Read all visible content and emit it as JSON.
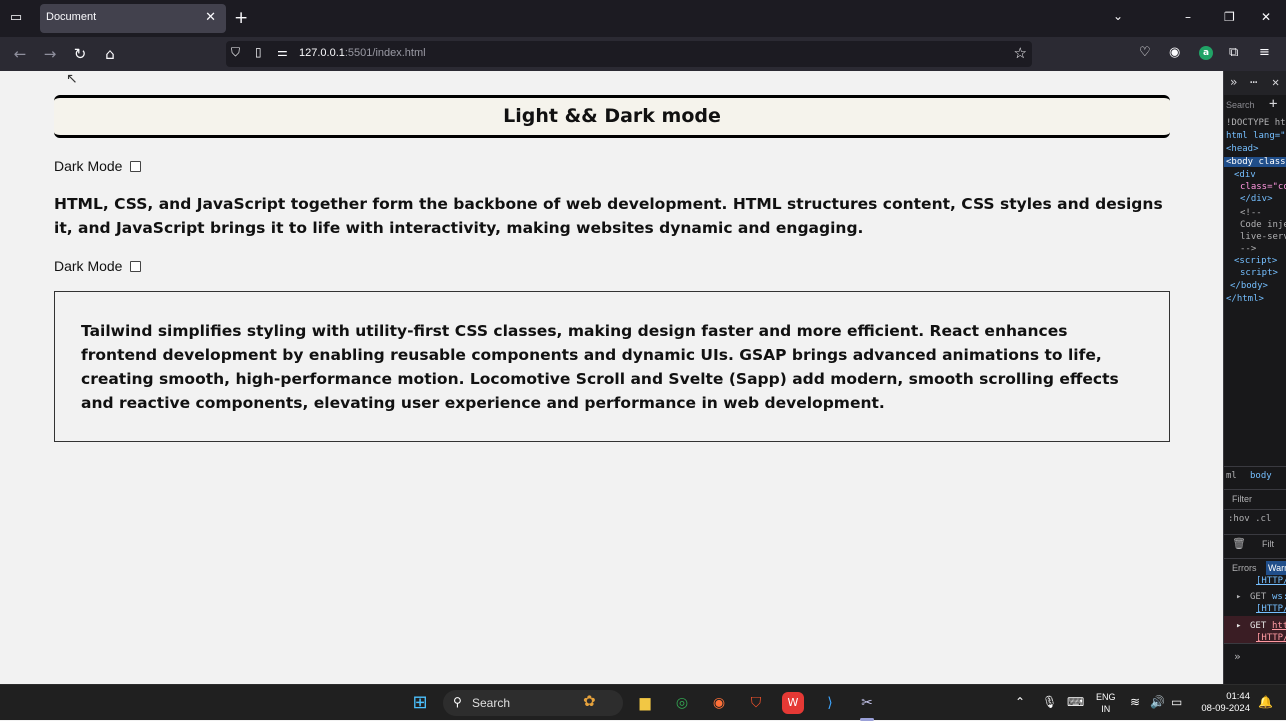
{
  "browser": {
    "tab_title": "Document",
    "url_host": "127.0.0.1",
    "url_path": ":5501/index.html"
  },
  "page": {
    "heading": "Light && Dark mode",
    "dark_mode_label_1": "Dark Mode",
    "dark_mode_label_2": "Dark Mode",
    "paragraph": "HTML, CSS, and JavaScript together form the backbone of web development. HTML structures content, CSS styles and designs it, and JavaScript brings it to life with interactivity, making websites dynamic and engaging.",
    "card_text": "Tailwind simplifies styling with utility-first CSS classes, making design faster and more efficient. React enhances frontend development by enabling reusable components and dynamic UIs. GSAP brings advanced animations to life, creating smooth, high-performance motion. Locomotive Scroll and Svelte (Sapp) add modern, smooth scrolling effects and reactive components, elevating user experience and performance in web development."
  },
  "devtools": {
    "search_placeholder": "Search",
    "lines": [
      "!DOCTYPE ht",
      "html lang=\"",
      "<head>",
      "<body class",
      "<div",
      "class=\"co",
      "</div>",
      "<!--",
      "Code inje",
      "live-serv",
      "-->",
      "<script>",
      "script>",
      "</body>",
      "</html>"
    ],
    "breadcrumb_1": "ml",
    "breadcrumb_2": "body",
    "filter_label": "Filter",
    "pseudo_label": ":hov .cl",
    "filter_label_2": "Filt",
    "tab_errors": "Errors",
    "tab_warnings": "Warn",
    "console_1_method": "GET",
    "console_1_url": "ws:",
    "console_1_tag": "[HTTP/",
    "console_2_method": "GET",
    "console_2_url": "htt",
    "console_2_tag": "[HTTP/",
    "console_top_tag": "[HTTP/"
  },
  "taskbar": {
    "search_label": "Search",
    "lang_line1": "ENG",
    "lang_line2": "IN",
    "time": "01:44",
    "date": "08-09-2024"
  },
  "icons": {
    "back": "back-arrow-icon",
    "forward": "forward-arrow-icon",
    "reload": "reload-icon",
    "home": "home-icon"
  }
}
